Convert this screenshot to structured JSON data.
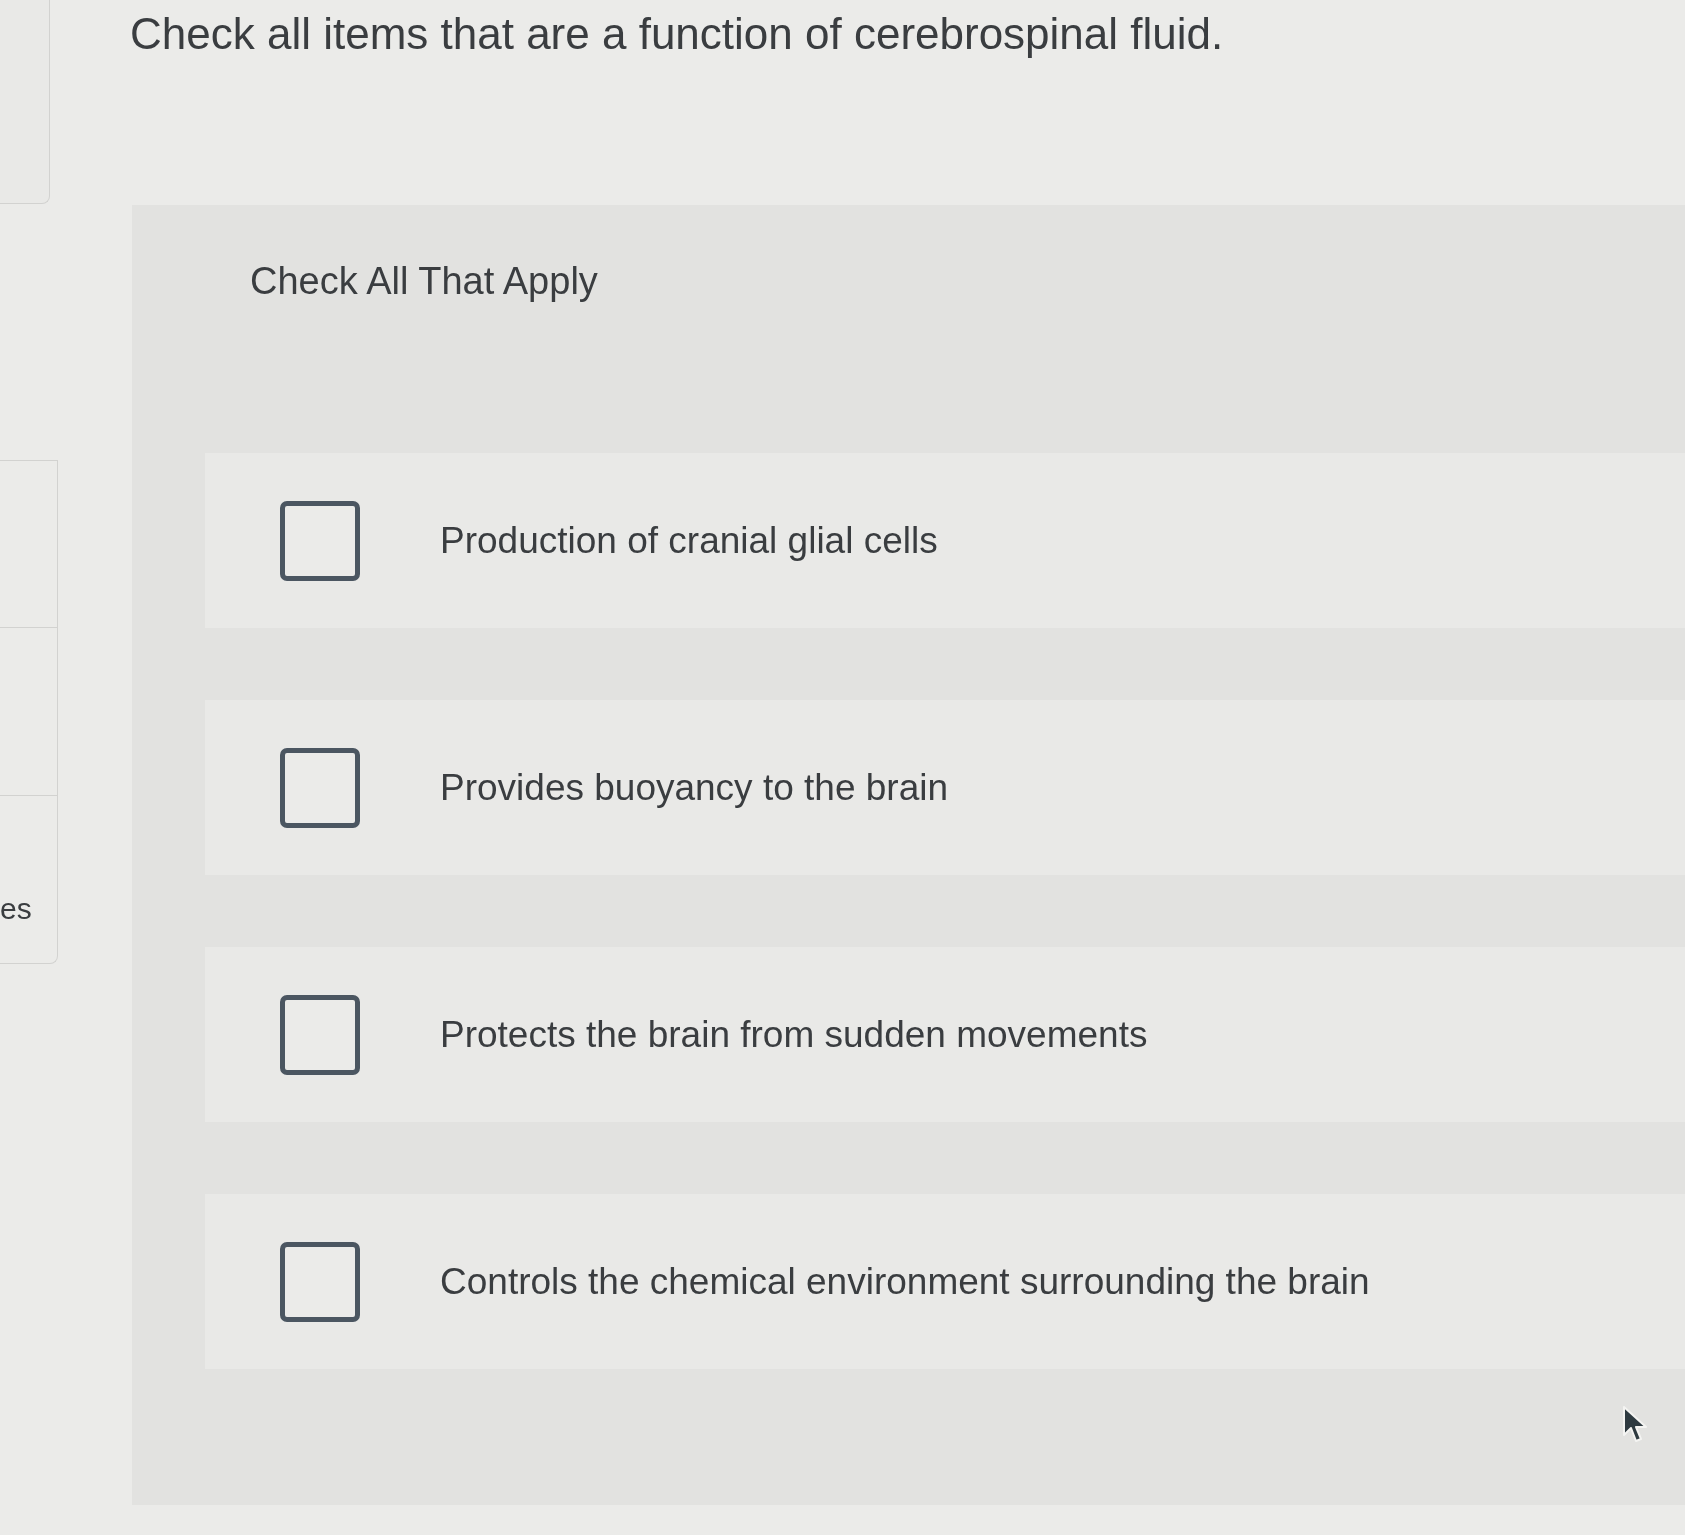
{
  "sidebar": {
    "label": "es"
  },
  "question": "Check all items that are a function of cerebrospinal fluid.",
  "instruction": "Check All That Apply",
  "options": [
    {
      "label": "Production of cranial glial cells",
      "checked": false
    },
    {
      "label": "Provides buoyancy to the brain",
      "checked": false
    },
    {
      "label": "Protects the brain from sudden movements",
      "checked": false
    },
    {
      "label": "Controls the chemical environment surrounding the brain",
      "checked": false
    }
  ]
}
